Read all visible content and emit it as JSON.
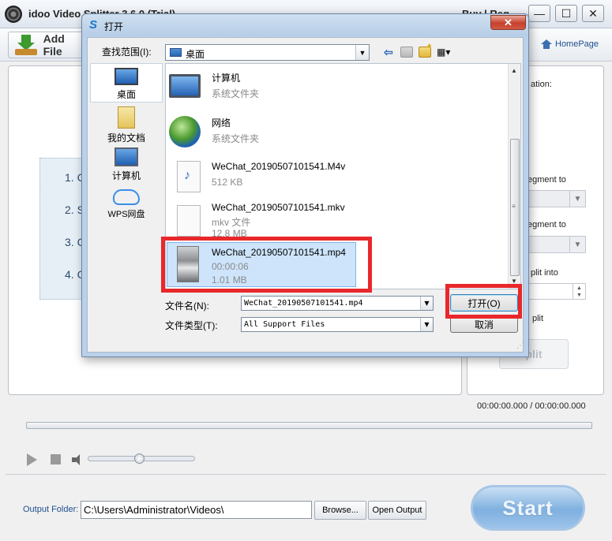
{
  "app": {
    "title": "idoo Video Splitter 3.6.0 (Trial)",
    "title_right": "Buy | Reg",
    "min": "—",
    "max": "☐",
    "close": "✕"
  },
  "toolbar": {
    "add_file": "Add File",
    "homepage": "HomePage"
  },
  "steps": [
    "1. C",
    "2. S",
    "3. C",
    "4. C"
  ],
  "right_panel": {
    "duration_label": "ation:",
    "segment_to_1": "egment to",
    "segment_to_2": "egment to",
    "split_into": "plit into",
    "split_label": "plit",
    "split_button": "plit"
  },
  "player": {
    "time": "00:00:00.000 / 00:00:00.000",
    "progress": 0,
    "volume": 0.45
  },
  "output": {
    "label": "Output Folder:",
    "path": "C:\\Users\\Administrator\\Videos\\",
    "browse": "Browse...",
    "open_output": "Open Output",
    "start": "Start"
  },
  "dialog": {
    "logo": "S",
    "title": "打开",
    "close": "✕",
    "look_in_label": "查找范围(I):",
    "look_in_value": "桌面",
    "places": [
      "桌面",
      "我的文档",
      "计算机",
      "WPS网盘"
    ],
    "files": [
      {
        "name": "计算机",
        "sub": "系统文件夹",
        "icon": "computer-icon"
      },
      {
        "name": "网络",
        "sub": "系统文件夹",
        "icon": "network-globe-icon"
      },
      {
        "name": "WeChat_20190507101541.M4v",
        "sub": "512 KB",
        "icon": "video-file-icon"
      },
      {
        "name": "WeChat_20190507101541.mkv",
        "sub": "mkv 文件",
        "sub2": "12.8 MB",
        "icon": "blank-file-icon"
      },
      {
        "name": "WeChat_20190507101541.mp4",
        "sub": "00:00:06",
        "sub2": "1.01 MB",
        "icon": "video-thumbnail-icon"
      }
    ],
    "filename_label": "文件名(N):",
    "filename_value": "WeChat_20190507101541.mp4",
    "filetype_label": "文件类型(T):",
    "filetype_value": "All Support Files",
    "open_button": "打开(O)",
    "cancel_button": "取消"
  },
  "colors": {
    "annotation": "#e8282b",
    "selection": "#cde4fb",
    "start_button": "#7fb0df"
  }
}
